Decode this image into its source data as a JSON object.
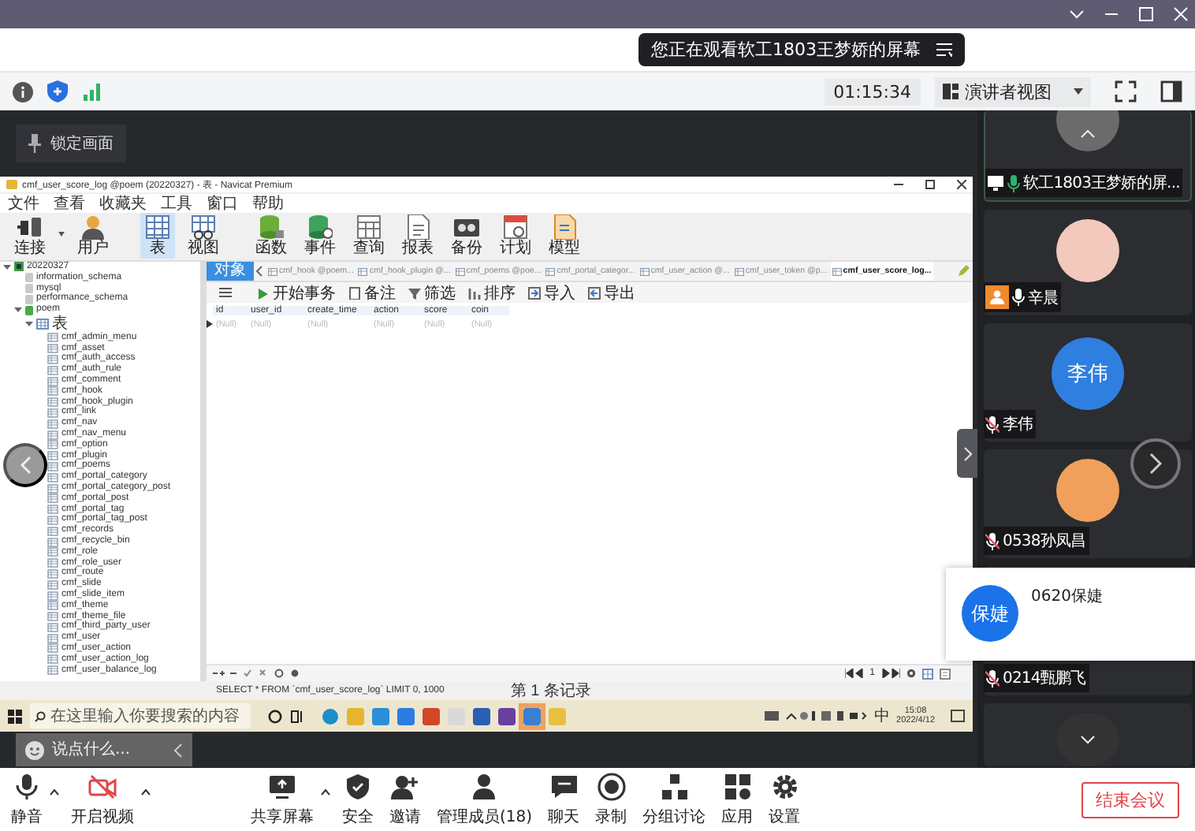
{
  "notice": {
    "text": "您正在观看软工1803王梦娇的屏幕"
  },
  "top_bar": {
    "timer": "01:15:34",
    "view_menu": "演讲者视图"
  },
  "stage": {
    "lock_button": "锁定画面",
    "chat": {
      "placeholder": "说点什么..."
    }
  },
  "shared_screen": {
    "app_title": "cmf_user_score_log @poem (20220327) - 表 - Navicat Premium",
    "menu": [
      "文件",
      "查看",
      "收藏夹",
      "工具",
      "窗口",
      "帮助"
    ],
    "toolbar": [
      {
        "label": "连接",
        "selected": false
      },
      {
        "label": "用户",
        "selected": false
      },
      {
        "label": "表",
        "selected": true
      },
      {
        "label": "视图",
        "selected": false
      },
      {
        "label": "函数",
        "selected": false
      },
      {
        "label": "事件",
        "selected": false
      },
      {
        "label": "查询",
        "selected": false
      },
      {
        "label": "报表",
        "selected": false
      },
      {
        "label": "备份",
        "selected": false
      },
      {
        "label": "计划",
        "selected": false
      },
      {
        "label": "模型",
        "selected": false
      }
    ],
    "tree": [
      {
        "label": "20220327",
        "kind": "connection",
        "expanded": true,
        "children": [
          {
            "label": "information_schema",
            "kind": "database"
          },
          {
            "label": "mysql",
            "kind": "database"
          },
          {
            "label": "performance_schema",
            "kind": "database"
          },
          {
            "label": "poem",
            "kind": "database",
            "expanded": true,
            "children": [
              {
                "label": "表",
                "kind": "folder",
                "expanded": true,
                "children": [
                  {
                    "label": "cmf_admin_menu",
                    "kind": "table"
                  },
                  {
                    "label": "cmf_asset",
                    "kind": "table"
                  },
                  {
                    "label": "cmf_auth_access",
                    "kind": "table"
                  },
                  {
                    "label": "cmf_auth_rule",
                    "kind": "table"
                  },
                  {
                    "label": "cmf_comment",
                    "kind": "table"
                  },
                  {
                    "label": "cmf_hook",
                    "kind": "table"
                  },
                  {
                    "label": "cmf_hook_plugin",
                    "kind": "table"
                  },
                  {
                    "label": "cmf_link",
                    "kind": "table"
                  },
                  {
                    "label": "cmf_nav",
                    "kind": "table"
                  },
                  {
                    "label": "cmf_nav_menu",
                    "kind": "table"
                  },
                  {
                    "label": "cmf_option",
                    "kind": "table"
                  },
                  {
                    "label": "cmf_plugin",
                    "kind": "table"
                  },
                  {
                    "label": "cmf_poems",
                    "kind": "table"
                  },
                  {
                    "label": "cmf_portal_category",
                    "kind": "table"
                  },
                  {
                    "label": "cmf_portal_category_post",
                    "kind": "table"
                  },
                  {
                    "label": "cmf_portal_post",
                    "kind": "table"
                  },
                  {
                    "label": "cmf_portal_tag",
                    "kind": "table"
                  },
                  {
                    "label": "cmf_portal_tag_post",
                    "kind": "table"
                  },
                  {
                    "label": "cmf_records",
                    "kind": "table"
                  },
                  {
                    "label": "cmf_recycle_bin",
                    "kind": "table"
                  },
                  {
                    "label": "cmf_role",
                    "kind": "table"
                  },
                  {
                    "label": "cmf_role_user",
                    "kind": "table"
                  },
                  {
                    "label": "cmf_route",
                    "kind": "table"
                  },
                  {
                    "label": "cmf_slide",
                    "kind": "table"
                  },
                  {
                    "label": "cmf_slide_item",
                    "kind": "table"
                  },
                  {
                    "label": "cmf_theme",
                    "kind": "table"
                  },
                  {
                    "label": "cmf_theme_file",
                    "kind": "table"
                  },
                  {
                    "label": "cmf_third_party_user",
                    "kind": "table"
                  },
                  {
                    "label": "cmf_user",
                    "kind": "table"
                  },
                  {
                    "label": "cmf_user_action",
                    "kind": "table"
                  },
                  {
                    "label": "cmf_user_action_log",
                    "kind": "table"
                  },
                  {
                    "label": "cmf_user_balance_log",
                    "kind": "table"
                  }
                ]
              }
            ]
          }
        ]
      }
    ],
    "object_tab": "对象",
    "tabs": [
      {
        "label": "cmf_hook @poem...",
        "selected": false
      },
      {
        "label": "cmf_hook_plugin @...",
        "selected": false
      },
      {
        "label": "cmf_poems @poe...",
        "selected": false
      },
      {
        "label": "cmf_portal_categor...",
        "selected": false
      },
      {
        "label": "cmf_user_action @...",
        "selected": false
      },
      {
        "label": "cmf_user_token @p...",
        "selected": false
      },
      {
        "label": "cmf_user_score_log...",
        "selected": true
      }
    ],
    "grid_toolbar": [
      "开始事务",
      "备注",
      "筛选",
      "排序",
      "导入",
      "导出"
    ],
    "columns": [
      "id",
      "user_id",
      "create_time",
      "action",
      "score",
      "coin"
    ],
    "row": [
      "(Null)",
      "(Null)",
      "(Null)",
      "(Null)",
      "(Null)",
      "(Null)"
    ],
    "page": "1",
    "sql": "SELECT * FROM `cmf_user_score_log` LIMIT 0, 1000",
    "record_status": "第 1 条记录",
    "taskbar": {
      "search": {
        "placeholder": "在这里输入你要搜索的内容"
      },
      "ime": "中",
      "time": "15:08",
      "date": "2022/4/12"
    }
  },
  "participants": [
    {
      "name": "软工1803王梦娇的屏...",
      "avatar": {
        "kind": "picture"
      },
      "speaking": true,
      "muted": false,
      "sharing": true,
      "host": false
    },
    {
      "name": "辛晨",
      "avatar": {
        "kind": "picture"
      },
      "speaking": false,
      "muted": false,
      "sharing": false,
      "host": true
    },
    {
      "name": "李伟",
      "avatar": {
        "kind": "initials",
        "initials": "李伟"
      },
      "speaking": false,
      "muted": true,
      "sharing": false,
      "host": false
    },
    {
      "name": "0538孙凤昌",
      "avatar": {
        "kind": "picture"
      },
      "speaking": false,
      "muted": true,
      "sharing": false,
      "host": false
    },
    {
      "name": "0214甄鹏飞",
      "speaking": false,
      "muted": true,
      "sharing": false,
      "host": false
    },
    {
      "avatar": {
        "kind": "picture"
      }
    }
  ],
  "popup": {
    "initials": "保婕",
    "name": "0620保婕"
  },
  "toolbar": [
    {
      "label": "静音",
      "caret": true
    },
    {
      "label": "开启视频",
      "caret": true
    },
    {
      "label": "共享屏幕",
      "caret": true
    },
    {
      "label": "安全",
      "caret": false
    },
    {
      "label": "邀请",
      "caret": false
    },
    {
      "label": "管理成员(18)",
      "caret": false
    },
    {
      "label": "聊天",
      "caret": false
    },
    {
      "label": "录制",
      "caret": false
    },
    {
      "label": "分组讨论",
      "caret": false
    },
    {
      "label": "应用",
      "caret": false
    },
    {
      "label": "设置",
      "caret": false
    }
  ],
  "end_button": "结束会议"
}
